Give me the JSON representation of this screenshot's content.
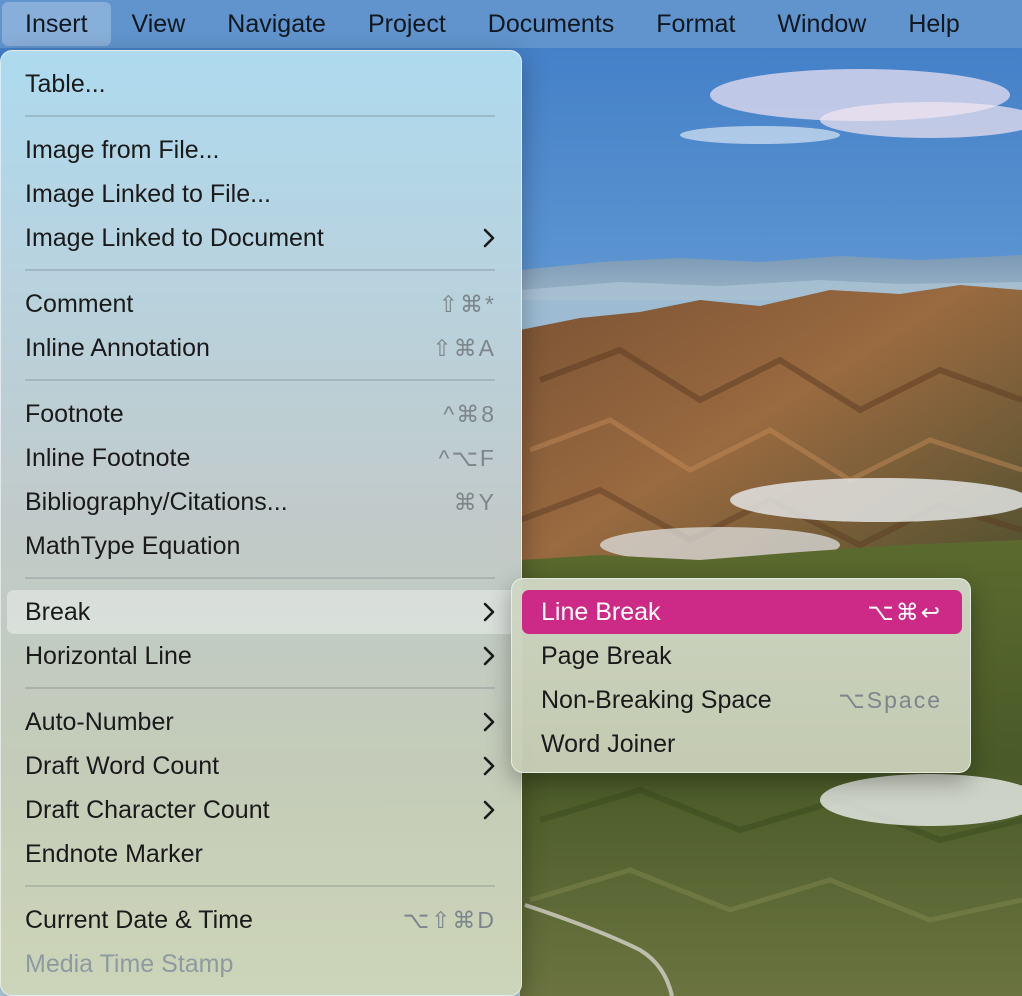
{
  "menubar": {
    "items": [
      "Insert",
      "View",
      "Navigate",
      "Project",
      "Documents",
      "Format",
      "Window",
      "Help"
    ]
  },
  "menu": {
    "table": "Table...",
    "image_from_file": "Image from File...",
    "image_linked_file": "Image Linked to File...",
    "image_linked_doc": "Image Linked to Document",
    "comment": "Comment",
    "comment_sc": "⇧⌘*",
    "inline_annotation": "Inline Annotation",
    "inline_annotation_sc": "⇧⌘A",
    "footnote": "Footnote",
    "footnote_sc": "^⌘8",
    "inline_footnote": "Inline Footnote",
    "inline_footnote_sc": "^⌥F",
    "bibliography": "Bibliography/Citations...",
    "bibliography_sc": "⌘Y",
    "mathtype": "MathType Equation",
    "break": "Break",
    "horizontal_line": "Horizontal Line",
    "auto_number": "Auto-Number",
    "draft_word_count": "Draft Word Count",
    "draft_char_count": "Draft Character Count",
    "endnote_marker": "Endnote Marker",
    "current_date_time": "Current Date & Time",
    "current_date_time_sc": "⌥⇧⌘D",
    "media_time_stamp": "Media Time Stamp"
  },
  "submenu": {
    "line_break": "Line Break",
    "line_break_sc": "⌥⌘↩",
    "page_break": "Page Break",
    "non_breaking_space": "Non-Breaking Space",
    "non_breaking_space_sc": "⌥Space",
    "word_joiner": "Word Joiner"
  },
  "colors": {
    "selection_accent": "#cc2a86"
  }
}
